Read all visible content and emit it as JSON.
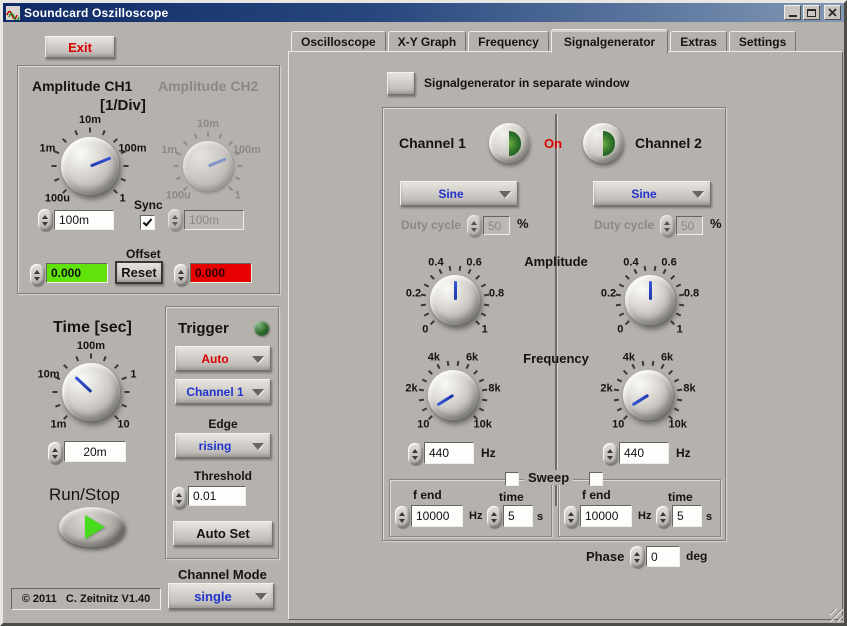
{
  "window": {
    "title": "Soundcard Oszilloscope"
  },
  "left": {
    "exit": "Exit",
    "amplitude": {
      "ch1_title": "Amplitude CH1",
      "ch2_title": "Amplitude CH2",
      "unit": "[1/Div]",
      "ticks": [
        "100u",
        "1m",
        "10m",
        "100m",
        "1"
      ],
      "ch1_value": "100m",
      "ch2_value": "100m",
      "sync_label": "Sync",
      "sync_checked": true,
      "offset_label": "Offset",
      "reset_label": "Reset",
      "offset_ch1": "0.000",
      "offset_ch2": "0.000",
      "offset_ch1_color": "#5fe30a",
      "offset_ch2_color": "#e60000"
    },
    "time": {
      "title": "Time [sec]",
      "ticks": [
        "1m",
        "10m",
        "100m",
        "1",
        "10"
      ],
      "value": "20m"
    },
    "trigger": {
      "title": "Trigger",
      "mode": "Auto",
      "source": "Channel 1",
      "edge_label": "Edge",
      "edge": "rising",
      "threshold_label": "Threshold",
      "threshold": "0.01",
      "autoset": "Auto Set",
      "mode_color": "#d90000",
      "value_color": "#2233cc"
    },
    "runstop_label": "Run/Stop",
    "channel_mode_label": "Channel Mode",
    "channel_mode": "single",
    "copyright": "© 2011   C. Zeitnitz V1.40"
  },
  "tabs": [
    {
      "label": "Oscilloscope",
      "active": false
    },
    {
      "label": "X-Y Graph",
      "active": false
    },
    {
      "label": "Frequency",
      "active": false
    },
    {
      "label": "Signalgenerator",
      "active": true
    },
    {
      "label": "Extras",
      "active": false
    },
    {
      "label": "Settings",
      "active": false
    }
  ],
  "gen": {
    "separate_window_label": "Signalgenerator in separate window",
    "separate_window_checked": false,
    "on_label": "On",
    "amplitude_label": "Amplitude",
    "frequency_label": "Frequency",
    "amp_ticks": [
      "0",
      "0.2",
      "0.4",
      "0.6",
      "0.8",
      "1"
    ],
    "freq_ticks": [
      "10",
      "2k",
      "4k",
      "6k",
      "8k",
      "10k"
    ],
    "sweep_label": "Sweep",
    "sweep_ch1_checked": false,
    "sweep_ch2_checked": false,
    "phase_label": "Phase",
    "phase_value": "0",
    "phase_unit": "deg",
    "ch1": {
      "title": "Channel 1",
      "wave": "Sine",
      "duty_label": "Duty cycle",
      "duty": "50",
      "pct": "%",
      "freq": "440",
      "hz": "Hz",
      "fend_label": "f end",
      "fend": "10000",
      "time_label": "time",
      "time": "5",
      "s": "s"
    },
    "ch2": {
      "title": "Channel 2",
      "wave": "Sine",
      "duty_label": "Duty cycle",
      "duty": "50",
      "pct": "%",
      "freq": "440",
      "hz": "Hz",
      "fend_label": "f end",
      "fend": "10000",
      "time_label": "time",
      "time": "5",
      "s": "s"
    }
  }
}
